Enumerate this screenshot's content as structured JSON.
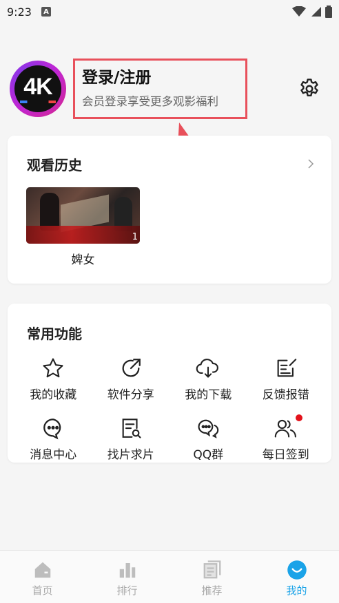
{
  "status_bar": {
    "time": "9:23",
    "notif_letter": "A"
  },
  "header": {
    "avatar_text": "4K",
    "login_title": "登录/注册",
    "login_subtitle": "会员登录享受更多观影福利",
    "settings_icon": "gear-icon"
  },
  "history": {
    "title": "观看历史",
    "items": [
      {
        "title": "婢女",
        "episode": "1"
      }
    ]
  },
  "functions": {
    "title": "常用功能",
    "items": [
      {
        "label": "我的收藏",
        "icon": "star-icon"
      },
      {
        "label": "软件分享",
        "icon": "share-icon"
      },
      {
        "label": "我的下载",
        "icon": "cloud-download-icon"
      },
      {
        "label": "反馈报错",
        "icon": "feedback-icon"
      },
      {
        "label": "消息中心",
        "icon": "message-icon"
      },
      {
        "label": "找片求片",
        "icon": "search-doc-icon"
      },
      {
        "label": "QQ群",
        "icon": "chat-icon"
      },
      {
        "label": "每日签到",
        "icon": "users-icon",
        "badge": true
      }
    ]
  },
  "bottom_nav": {
    "items": [
      {
        "label": "首页",
        "icon": "home-icon"
      },
      {
        "label": "排行",
        "icon": "chart-icon"
      },
      {
        "label": "推荐",
        "icon": "recommend-icon"
      },
      {
        "label": "我的",
        "icon": "profile-icon",
        "active": true
      }
    ]
  },
  "colors": {
    "accent": "#1aa3e8",
    "annotation": "#e8505b",
    "badge": "#e3121b"
  }
}
